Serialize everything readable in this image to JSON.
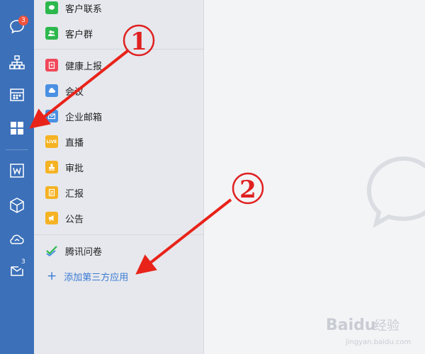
{
  "rail": {
    "messages_badge": "3",
    "mail_badge": "3",
    "items": [
      {
        "name": "messages",
        "icon": "chat-bubble-icon"
      },
      {
        "name": "contacts",
        "icon": "org-chart-icon"
      },
      {
        "name": "calendar",
        "icon": "calendar-icon"
      },
      {
        "name": "workbench",
        "icon": "grid-apps-icon"
      },
      {
        "name": "docs",
        "icon": "document-w-icon"
      },
      {
        "name": "cube",
        "icon": "cube-icon"
      },
      {
        "name": "cloud",
        "icon": "cloud-icon"
      },
      {
        "name": "mail",
        "icon": "mail-icon"
      }
    ]
  },
  "apps": {
    "items": [
      {
        "label": "客户联系",
        "icon": "wechat-icon",
        "color": "#2db84d"
      },
      {
        "label": "客户群",
        "icon": "group-icon",
        "color": "#2db84d"
      },
      {
        "label": "健康上报",
        "icon": "report-icon",
        "color": "#f0485a"
      },
      {
        "label": "会议",
        "icon": "cloud-meeting-icon",
        "color": "#4a90e2"
      },
      {
        "label": "企业邮箱",
        "icon": "envelope-icon",
        "color": "#4a90e2"
      },
      {
        "label": "直播",
        "icon": "live-icon",
        "color": "#f5b323",
        "icon_text": "LIVE"
      },
      {
        "label": "审批",
        "icon": "stamp-icon",
        "color": "#f5b323"
      },
      {
        "label": "汇报",
        "icon": "document-icon",
        "color": "#f5b323"
      },
      {
        "label": "公告",
        "icon": "megaphone-icon",
        "color": "#f5b323"
      }
    ],
    "extra": [
      {
        "label": "腾讯问卷",
        "icon": "check-survey-icon",
        "color": "#2db84d"
      }
    ],
    "add_label": "添加第三方应用",
    "add_symbol": "+"
  },
  "annotations": {
    "marker1": "1",
    "marker2": "2",
    "arrow_color": "#e8231a"
  },
  "watermark": {
    "brand": "Baidu",
    "suffix": "经验",
    "url": "jingyan.baidu.com"
  }
}
